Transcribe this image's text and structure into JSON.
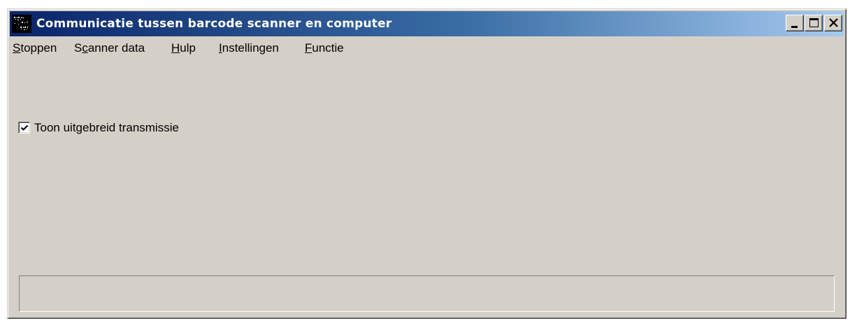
{
  "window": {
    "title": "Communicatie tussen barcode scanner en computer",
    "app_icon": "barcode-scanner-app-icon",
    "controls": {
      "minimize_icon": "minimize-icon",
      "maximize_icon": "maximize-icon",
      "close_icon": "close-icon"
    }
  },
  "menubar": {
    "items": [
      {
        "label": "Stoppen",
        "mnemonic": "S"
      },
      {
        "label": "Scanner data",
        "mnemonic": "c"
      },
      {
        "label": "Hulp",
        "mnemonic": "H"
      },
      {
        "label": "Instellingen",
        "mnemonic": "I"
      },
      {
        "label": "Functie",
        "mnemonic": "F"
      }
    ]
  },
  "options": {
    "show_extended_transmission": {
      "label": "Toon uitgebreid transmissie",
      "checked": true
    }
  },
  "status_panel": {
    "text": ""
  },
  "colors": {
    "title_start": "#0a246a",
    "title_end": "#a6caf0",
    "face": "#d4d0c8"
  }
}
